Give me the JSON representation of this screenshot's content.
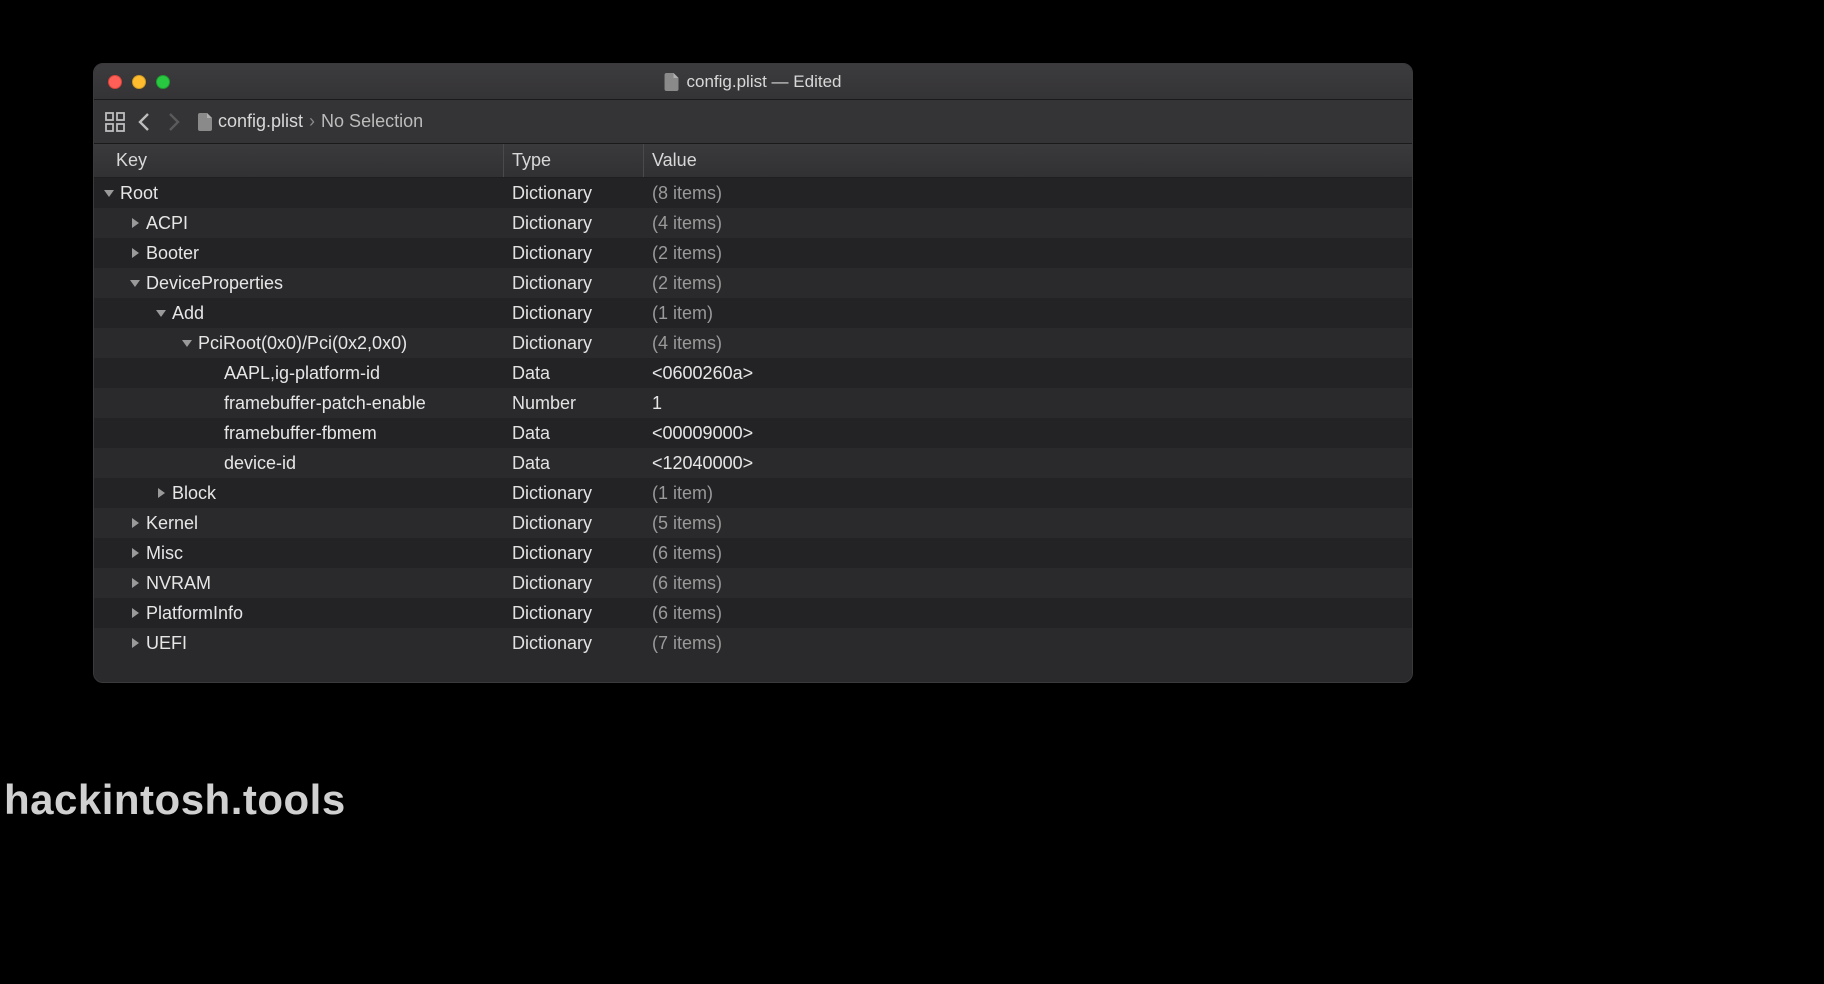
{
  "window": {
    "title": "config.plist — Edited",
    "filename": "config.plist"
  },
  "breadcrumb": {
    "file": "config.plist",
    "selection": "No Selection"
  },
  "columns": {
    "key": "Key",
    "type": "Type",
    "value": "Value"
  },
  "rows": [
    {
      "indent": 0,
      "disclosure": "down",
      "key": "Root",
      "type": "Dictionary",
      "value": "(8 items)",
      "dim": true
    },
    {
      "indent": 1,
      "disclosure": "right",
      "key": "ACPI",
      "type": "Dictionary",
      "value": "(4 items)",
      "dim": true
    },
    {
      "indent": 1,
      "disclosure": "right",
      "key": "Booter",
      "type": "Dictionary",
      "value": "(2 items)",
      "dim": true
    },
    {
      "indent": 1,
      "disclosure": "down",
      "key": "DeviceProperties",
      "type": "Dictionary",
      "value": "(2 items)",
      "dim": true
    },
    {
      "indent": 2,
      "disclosure": "down",
      "key": "Add",
      "type": "Dictionary",
      "value": "(1 item)",
      "dim": true
    },
    {
      "indent": 3,
      "disclosure": "down",
      "key": "PciRoot(0x0)/Pci(0x2,0x0)",
      "type": "Dictionary",
      "value": "(4 items)",
      "dim": true
    },
    {
      "indent": 4,
      "disclosure": "none",
      "key": "AAPL,ig-platform-id",
      "type": "Data",
      "value": "<0600260a>",
      "dim": false
    },
    {
      "indent": 4,
      "disclosure": "none",
      "key": "framebuffer-patch-enable",
      "type": "Number",
      "value": "1",
      "dim": false
    },
    {
      "indent": 4,
      "disclosure": "none",
      "key": "framebuffer-fbmem",
      "type": "Data",
      "value": "<00009000>",
      "dim": false
    },
    {
      "indent": 4,
      "disclosure": "none",
      "key": "device-id",
      "type": "Data",
      "value": "<12040000>",
      "dim": false
    },
    {
      "indent": 2,
      "disclosure": "right",
      "key": "Block",
      "type": "Dictionary",
      "value": "(1 item)",
      "dim": true
    },
    {
      "indent": 1,
      "disclosure": "right",
      "key": "Kernel",
      "type": "Dictionary",
      "value": "(5 items)",
      "dim": true
    },
    {
      "indent": 1,
      "disclosure": "right",
      "key": "Misc",
      "type": "Dictionary",
      "value": "(6 items)",
      "dim": true
    },
    {
      "indent": 1,
      "disclosure": "right",
      "key": "NVRAM",
      "type": "Dictionary",
      "value": "(6 items)",
      "dim": true
    },
    {
      "indent": 1,
      "disclosure": "right",
      "key": "PlatformInfo",
      "type": "Dictionary",
      "value": "(6 items)",
      "dim": true
    },
    {
      "indent": 1,
      "disclosure": "right",
      "key": "UEFI",
      "type": "Dictionary",
      "value": "(7 items)",
      "dim": true
    }
  ],
  "watermark": "hackintosh.tools"
}
